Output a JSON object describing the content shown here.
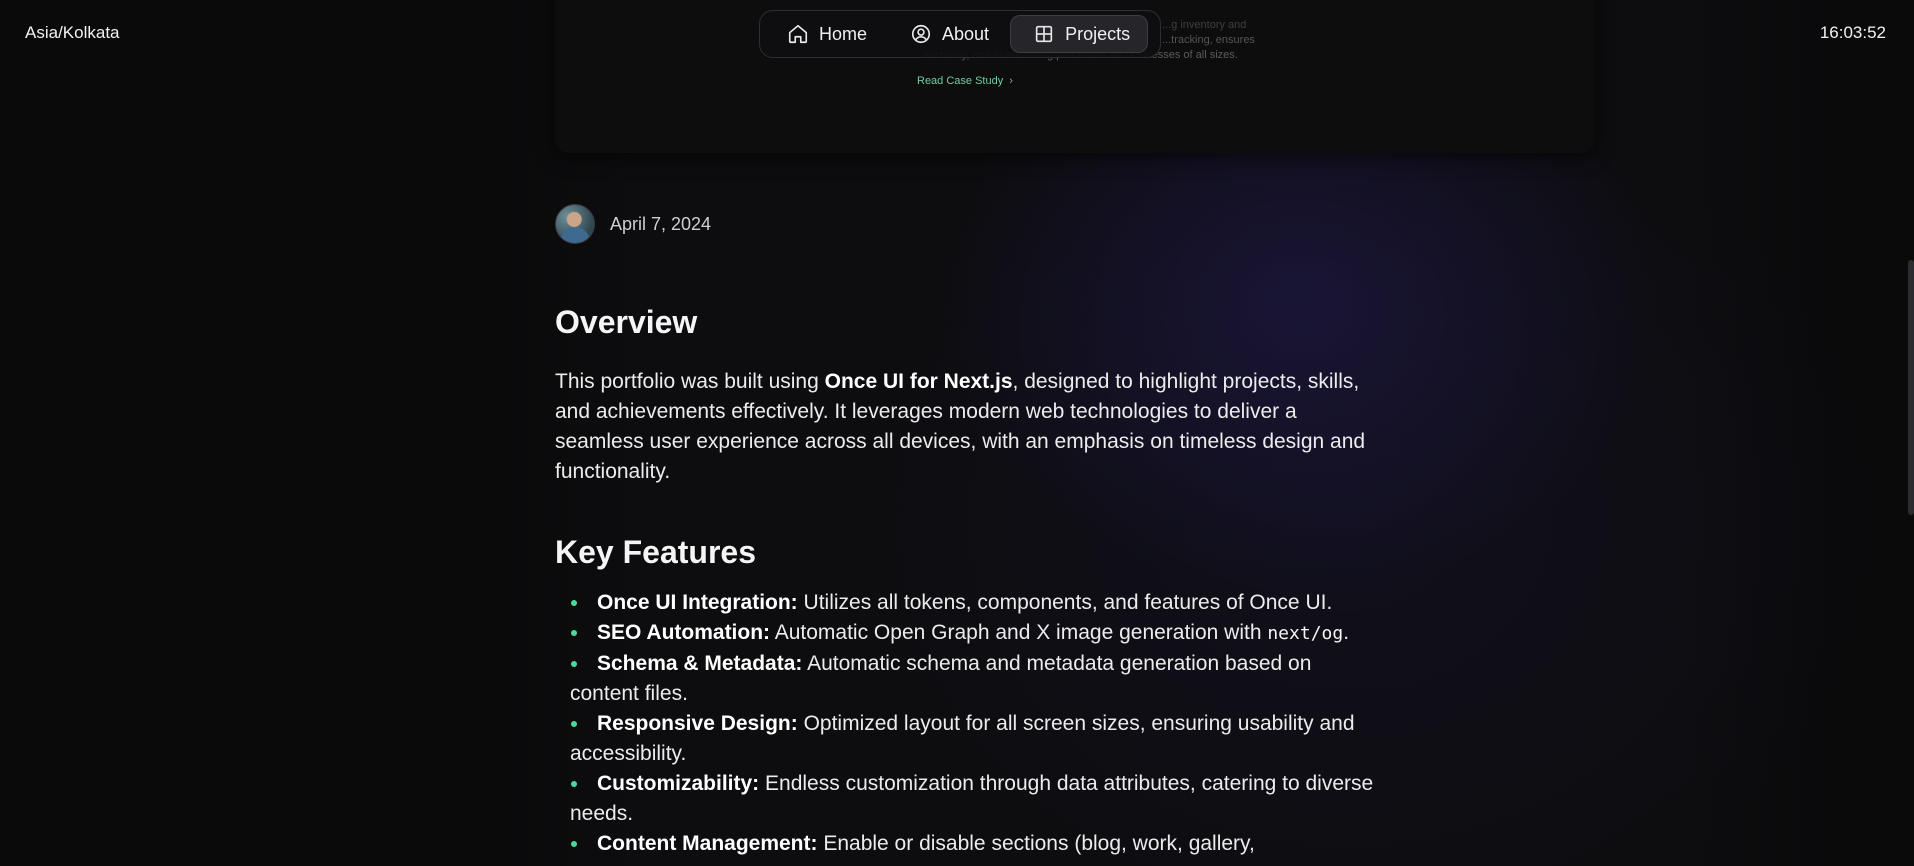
{
  "header": {
    "timezone": "Asia/Kolkata",
    "clock": "16:03:52",
    "nav": [
      {
        "label": "Home",
        "icon": "home-icon",
        "active": false
      },
      {
        "label": "About",
        "icon": "person-icon",
        "active": false
      },
      {
        "label": "Projects",
        "icon": "grid-icon",
        "active": true
      }
    ]
  },
  "card": {
    "fade_lines": [
      "...g inventory and",
      "...tracking, ensures",
      "...accuracy, and streamlining processes for businesses of all sizes."
    ],
    "link_label": "Read Case Study"
  },
  "post": {
    "date": "April 7, 2024",
    "overview_heading": "Overview",
    "overview_prefix": "This portfolio was built using ",
    "overview_bold": "Once UI for Next.js",
    "overview_suffix": ", designed to highlight projects, skills, and achievements effectively. It leverages modern web technologies to deliver a seamless user experience across all devices, with an emphasis on timeless design and functionality.",
    "features_heading": "Key Features",
    "features": [
      {
        "title": "Once UI Integration:",
        "text": " Utilizes all tokens, components, and features of Once UI."
      },
      {
        "title": "SEO Automation:",
        "text": " Automatic Open Graph and X image generation with ",
        "code": "next/og",
        "after": "."
      },
      {
        "title": "Schema & Metadata:",
        "text": " Automatic schema and metadata generation based on content files."
      },
      {
        "title": "Responsive Design:",
        "text": " Optimized layout for all screen sizes, ensuring usability and accessibility."
      },
      {
        "title": "Customizability:",
        "text": " Endless customization through data attributes, catering to diverse needs."
      },
      {
        "title": "Content Management:",
        "text": " Enable or disable sections (blog, work, gallery,"
      }
    ]
  },
  "colors": {
    "accent_green": "#4ed79b",
    "link_green": "#6fcf9f",
    "background": "#0a0a0b"
  }
}
